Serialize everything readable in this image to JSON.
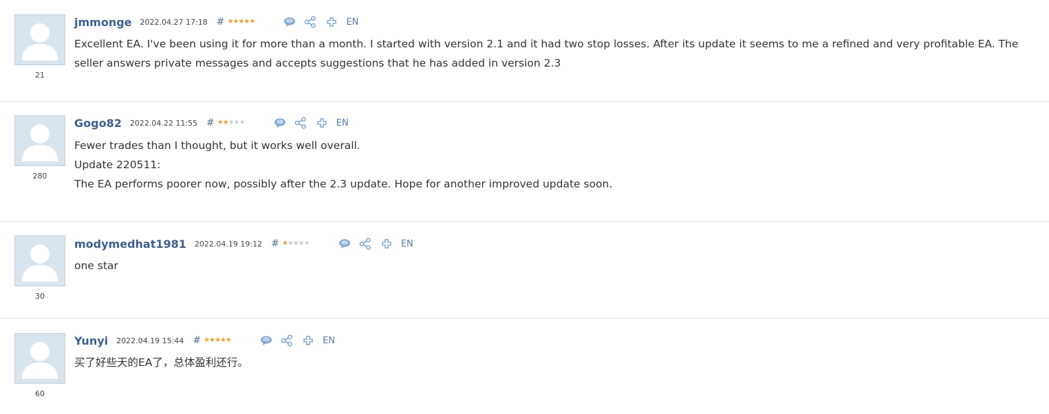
{
  "reviews": [
    {
      "author": "jmmonge",
      "date": "2022.04.27 17:18",
      "hash": "#",
      "stars": 5,
      "lang": "EN",
      "rating_count": "21",
      "lines": [
        "Excellent EA. I've been using it for more than a month. I started with version 2.1 and it had two stop losses. After its update it seems to me a refined and very profitable EA. The seller answers private messages and accepts suggestions that he has added in version 2.3"
      ]
    },
    {
      "author": "Gogo82",
      "date": "2022.04.22 11:55",
      "hash": "#",
      "stars": 2,
      "lang": "EN",
      "rating_count": "280",
      "lines": [
        "Fewer trades than I thought, but it works well overall.",
        "Update 220511:",
        "The EA performs poorer now, possibly after the 2.3 update. Hope for another improved update soon."
      ]
    },
    {
      "author": "modymedhat1981",
      "date": "2022.04.19 19:12",
      "hash": "#",
      "stars": 1,
      "lang": "EN",
      "rating_count": "30",
      "lines": [
        "one star"
      ]
    },
    {
      "author": "Yunyi",
      "date": "2022.04.19 15:44",
      "hash": "#",
      "stars": 5,
      "lang": "EN",
      "rating_count": "60",
      "lines": [
        "买了好些天的EA了，总体盈利还行。"
      ]
    }
  ],
  "icons": {
    "reply": "speech-bubble-icon",
    "share": "share-icon",
    "add": "plus-icon"
  },
  "colors": {
    "author": "#3f5f8f",
    "star_on": "#f0a030",
    "star_off": "#cdcdcd",
    "icon": "#7fa6d0"
  }
}
